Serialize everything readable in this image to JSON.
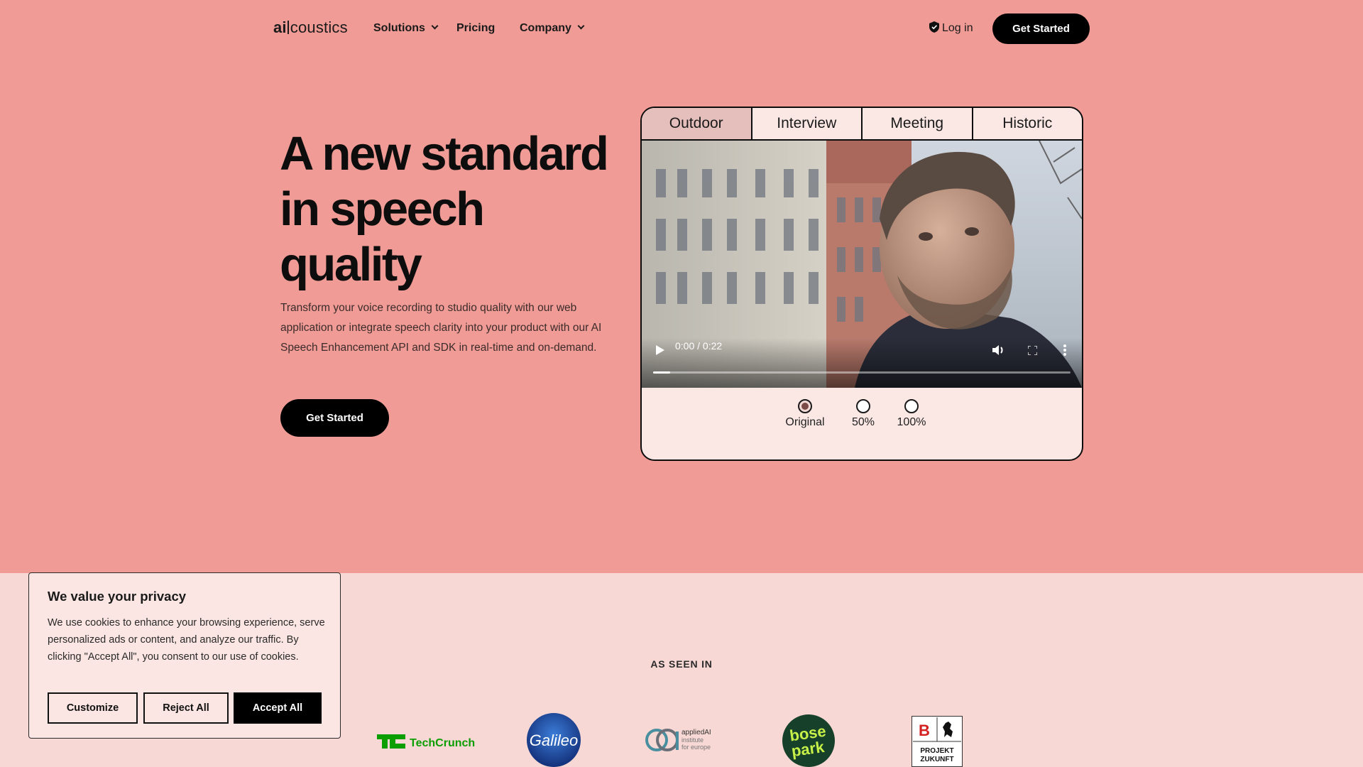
{
  "brand": {
    "logo_ai": "ai",
    "logo_rest": "coustics"
  },
  "nav": {
    "solutions": "Solutions",
    "pricing": "Pricing",
    "company": "Company",
    "login": "Log in",
    "cta": "Get Started"
  },
  "hero": {
    "title": "A new standard in speech quality",
    "subtitle": "Transform your voice recording to studio quality with our web application or integrate speech clarity into your product with our AI Speech Enhancement API and SDK in real-time and on-demand.",
    "cta": "Get Started"
  },
  "demo": {
    "tabs": [
      {
        "label": "Outdoor",
        "active": true
      },
      {
        "label": "Interview",
        "active": false
      },
      {
        "label": "Meeting",
        "active": false
      },
      {
        "label": "Historic",
        "active": false
      }
    ],
    "video": {
      "time": "0:00 / 0:22",
      "progress": 0.04
    },
    "options": [
      {
        "label": "Original",
        "selected": true
      },
      {
        "label": "50%",
        "selected": false
      },
      {
        "label": "100%",
        "selected": false
      }
    ]
  },
  "press": {
    "heading": "AS SEEN IN",
    "logos": [
      "TechCrunch",
      "Galileo",
      "appliedAI",
      "institute",
      "for europe",
      "bose",
      "park",
      "PROJEKT",
      "ZUKUNFT"
    ]
  },
  "cookie": {
    "title": "We value your privacy",
    "body": "We use cookies to enhance your browsing experience, serve personalized ads or content, and analyze our traffic. By clicking \"Accept All\", you consent to our use of cookies.",
    "customize": "Customize",
    "reject": "Reject All",
    "accept": "Accept All"
  },
  "colors": {
    "background": "#f09b95",
    "band": "#f7d8d4",
    "accent": "#000000",
    "card": "#fbe8e5"
  }
}
